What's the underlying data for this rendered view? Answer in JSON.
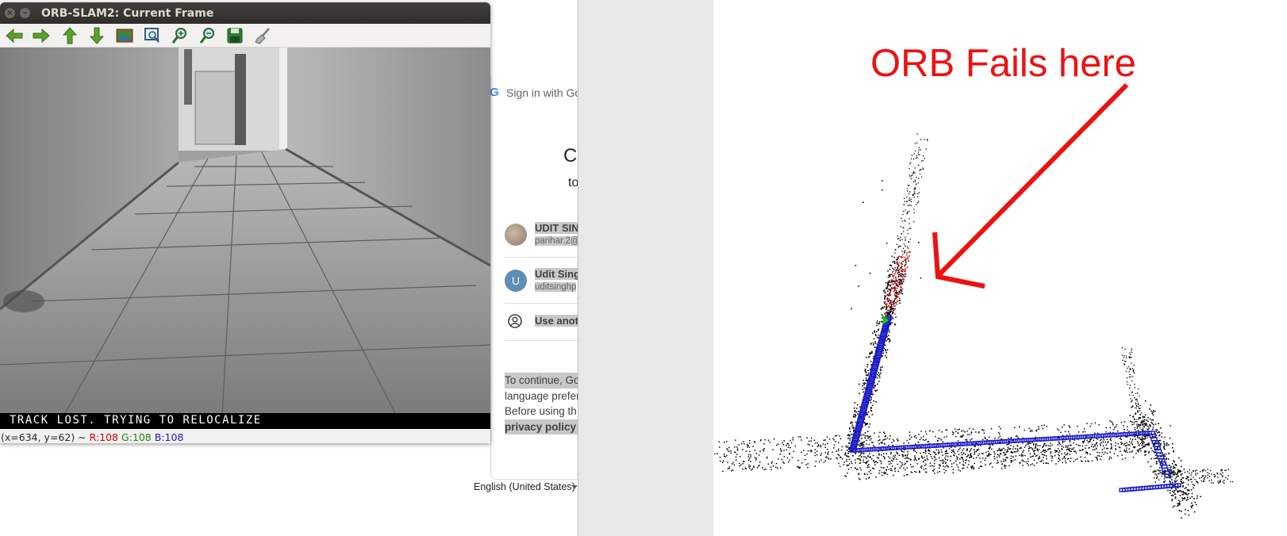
{
  "orb_window": {
    "title": "ORB-SLAM2: Current Frame",
    "toolbar": [
      {
        "name": "back-arrow-icon"
      },
      {
        "name": "forward-arrow-icon"
      },
      {
        "name": "up-arrow-icon"
      },
      {
        "name": "down-arrow-icon"
      },
      {
        "name": "image-icon"
      },
      {
        "name": "zoom-fit-icon"
      },
      {
        "name": "zoom-in-icon"
      },
      {
        "name": "zoom-out-icon"
      },
      {
        "name": "save-icon"
      },
      {
        "name": "clear-brush-icon"
      }
    ],
    "status_overlay": "TRACK LOST. TRYING TO RELOCALIZE",
    "pixel_info": {
      "coords": "(x=634, y=62) ~",
      "r": "R:108",
      "g": "G:108",
      "b": "B:108"
    }
  },
  "google_page": {
    "signin_link": "Sign in with Go",
    "heading": "C",
    "subheading": "to",
    "accounts": [
      {
        "name": "UDIT SIN",
        "email": "parihar.2@"
      },
      {
        "name": "Udit Sing",
        "email": "uditsinghp",
        "initial": "U"
      }
    ],
    "use_another": "Use anot",
    "continue_lines": [
      "To continue, Go",
      "language prefer",
      "Before using th",
      "privacy policy a"
    ],
    "language": "English (United States)"
  },
  "map_viewer": {
    "annotation": "ORB Fails here"
  },
  "colors": {
    "annotation": "#ee1111",
    "keyframes": "#1a1acc",
    "local_points": "#cc1111",
    "current_camera": "#11cc11"
  }
}
